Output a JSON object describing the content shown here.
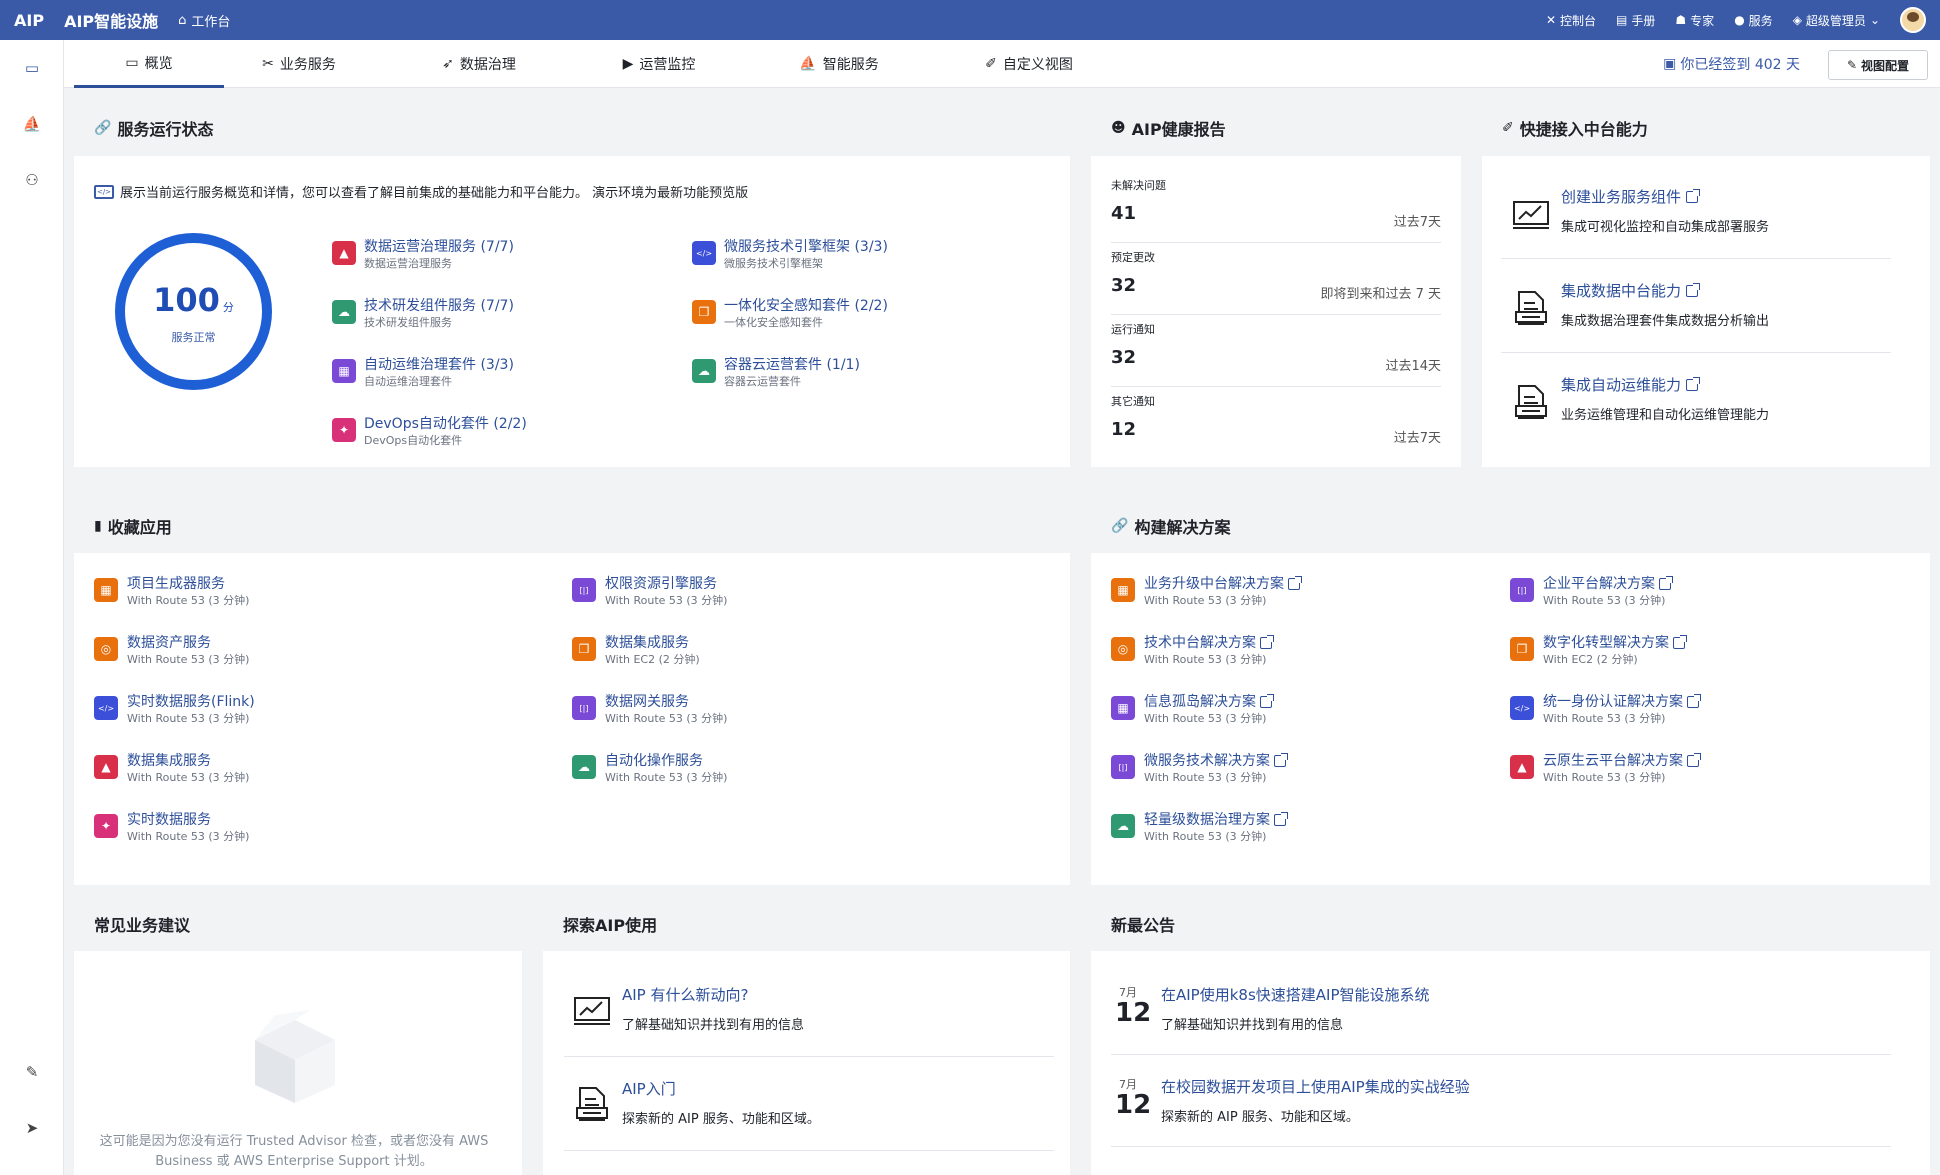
{
  "topbar": {
    "brand": "AIP",
    "app_title": "AIP智能设施",
    "home": "工作台",
    "links": [
      "控制台",
      "手册",
      "专家",
      "服务",
      "超级管理员"
    ]
  },
  "tabs": [
    "概览",
    "业务服务",
    "数据治理",
    "运营监控",
    "智能服务",
    "自定义视图"
  ],
  "signin_text": "你已经签到 402 天",
  "view_config": "视图配置",
  "service_status": {
    "title": "服务运行状态",
    "description": "展示当前运行服务概览和详情，您可以查看了解目前集成的基础能力和平台能力。 演示环境为最新功能预览版",
    "score": "100",
    "score_unit": "分",
    "score_status": "服务正常",
    "services": [
      {
        "title": "数据运营治理服务 (7/7)",
        "sub": "数据运营治理服务",
        "icon": "warning-icon",
        "color": "#d9304a"
      },
      {
        "title": "微服务技术引擎框架 (3/3)",
        "sub": "微服务技术引擎框架",
        "icon": "code-icon",
        "color": "#3b4fd9"
      },
      {
        "title": "技术研发组件服务 (7/7)",
        "sub": "技术研发组件服务",
        "icon": "cloud-icon",
        "color": "#2f9a72"
      },
      {
        "title": "一体化安全感知套件 (2/2)",
        "sub": "一体化安全感知套件",
        "icon": "copy-icon",
        "color": "#e8700d"
      },
      {
        "title": "自动运维治理套件 (3/3)",
        "sub": "自动运维治理套件",
        "icon": "chip-icon",
        "color": "#7a49d6"
      },
      {
        "title": "容器云运营套件 (1/1)",
        "sub": "容器云运营套件",
        "icon": "cloud-icon",
        "color": "#2f9a72"
      },
      {
        "title": "DevOps自动化套件 (2/2)",
        "sub": "DevOps自动化套件",
        "icon": "magic-icon",
        "color": "#d9307a"
      }
    ]
  },
  "health": {
    "title": "AIP健康报告",
    "rows": [
      {
        "label": "未解决问题",
        "value": "41",
        "period": "过去7天"
      },
      {
        "label": "预定更改",
        "value": "32",
        "period": "即将到来和过去 7 天"
      },
      {
        "label": "运行通知",
        "value": "32",
        "period": "过去14天"
      },
      {
        "label": "其它通知",
        "value": "12",
        "period": "过去7天"
      }
    ]
  },
  "quick": {
    "title": "快捷接入中台能力",
    "items": [
      {
        "title": "创建业务服务组件",
        "sub": "集成可视化监控和自动集成部署服务",
        "icon": "chart-icon"
      },
      {
        "title": "集成数据中台能力",
        "sub": "集成数据治理套件集成数据分析输出",
        "icon": "document-icon"
      },
      {
        "title": "集成自动运维能力",
        "sub": "业务运维管理和自动化运维管理能力",
        "icon": "document-icon"
      }
    ]
  },
  "favorites": {
    "title": "收藏应用",
    "items": [
      {
        "title": "项目生成器服务",
        "sub": "With Route 53 (3 分钟)",
        "icon": "grid-icon",
        "color": "#e8700d"
      },
      {
        "title": "权限资源引擎服务",
        "sub": "With Route 53 (3 分钟)",
        "icon": "bracket-icon",
        "color": "#7a49d6"
      },
      {
        "title": "数据资产服务",
        "sub": "With Route 53 (3 分钟)",
        "icon": "target-icon",
        "color": "#e8700d"
      },
      {
        "title": "数据集成服务",
        "sub": "With EC2 (2 分钟)",
        "icon": "copy-icon",
        "color": "#e8700d"
      },
      {
        "title": "实时数据服务(Flink)",
        "sub": "With Route 53 (3 分钟)",
        "icon": "code-icon",
        "color": "#3b4fd9"
      },
      {
        "title": "数据网关服务",
        "sub": "With Route 53 (3 分钟)",
        "icon": "bracket-icon",
        "color": "#7a49d6"
      },
      {
        "title": "数据集成服务",
        "sub": "With Route 53 (3 分钟)",
        "icon": "warning-icon",
        "color": "#d9304a"
      },
      {
        "title": "自动化操作服务",
        "sub": "With Route 53 (3 分钟)",
        "icon": "cloud-icon",
        "color": "#2f9a72"
      },
      {
        "title": "实时数据服务",
        "sub": "With Route 53 (3 分钟)",
        "icon": "magic-icon",
        "color": "#d9307a"
      }
    ]
  },
  "solutions": {
    "title": "构建解决方案",
    "items": [
      {
        "title": "业务升级中台解决方案",
        "sub": "With Route 53 (3 分钟)",
        "icon": "grid-icon",
        "color": "#e8700d"
      },
      {
        "title": "企业平台解决方案",
        "sub": "With Route 53 (3 分钟)",
        "icon": "bracket-icon",
        "color": "#7a49d6"
      },
      {
        "title": "技术中台解决方案",
        "sub": "With Route 53 (3 分钟)",
        "icon": "target-icon",
        "color": "#e8700d"
      },
      {
        "title": "数字化转型解决方案",
        "sub": "With EC2 (2 分钟)",
        "icon": "copy-icon",
        "color": "#e8700d"
      },
      {
        "title": "信息孤岛解决方案",
        "sub": "With Route 53 (3 分钟)",
        "icon": "chip-icon",
        "color": "#7a49d6"
      },
      {
        "title": "统一身份认证解决方案",
        "sub": "With Route 53 (3 分钟)",
        "icon": "code-icon",
        "color": "#3b4fd9"
      },
      {
        "title": "微服务技术解决方案",
        "sub": "With Route 53 (3 分钟)",
        "icon": "bracket-icon",
        "color": "#7a49d6"
      },
      {
        "title": "云原生云平台解决方案",
        "sub": "With Route 53 (3 分钟)",
        "icon": "warning-icon",
        "color": "#d9304a"
      },
      {
        "title": "轻量级数据治理方案",
        "sub": "With Route 53 (3 分钟)",
        "icon": "cloud-icon",
        "color": "#2f9a72"
      }
    ]
  },
  "suggest": {
    "title": "常见业务建议",
    "empty_text": "这可能是因为您没有运行 Trusted Advisor 检查，或者您没有 AWS Business 或 AWS Enterprise Support 计划。"
  },
  "explore": {
    "title": "探索AIP使用",
    "items": [
      {
        "title": "AIP 有什么新动向?",
        "sub": "了解基础知识并找到有用的信息",
        "icon": "chart-icon"
      },
      {
        "title": "AIP入门",
        "sub": "探索新的 AIP 服务、功能和区域。",
        "icon": "document-icon"
      }
    ]
  },
  "news": {
    "title": "新最公告",
    "items": [
      {
        "month": "7月",
        "day": "12",
        "title": "在AIP使用k8s快速搭建AIP智能设施系统",
        "sub": "了解基础知识并找到有用的信息"
      },
      {
        "month": "7月",
        "day": "12",
        "title": "在校园数据开发项目上使用AIP集成的实战经验",
        "sub": "探索新的 AIP 服务、功能和区域。"
      }
    ]
  }
}
